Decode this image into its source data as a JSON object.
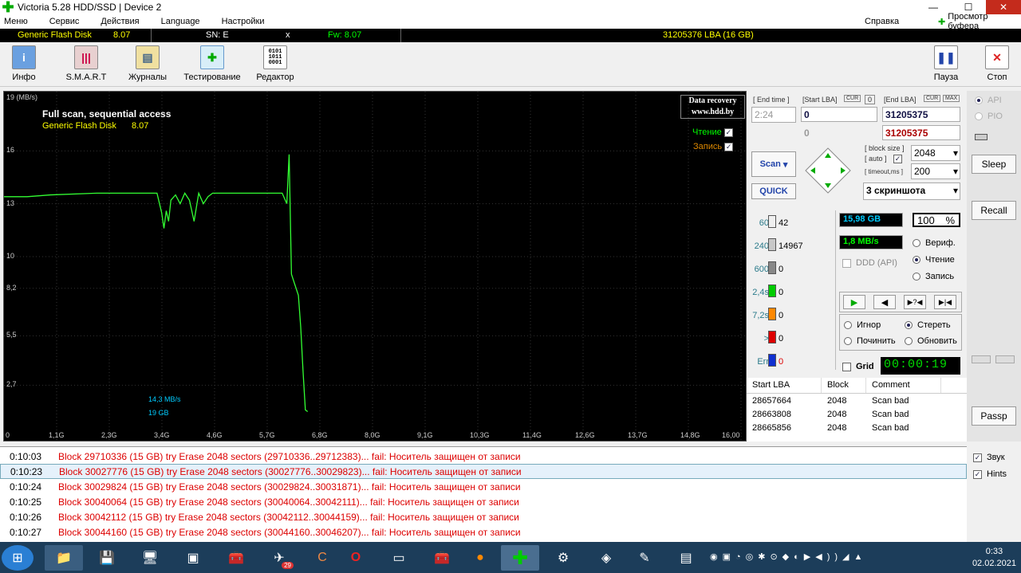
{
  "window": {
    "title": "Victoria 5.28 HDD/SSD | Device 2"
  },
  "menu": {
    "items": [
      "Меню",
      "Сервис",
      "Действия",
      "Language",
      "Настройки"
    ],
    "help": "Справка",
    "clipboard": "Просмотр буфера"
  },
  "device": {
    "name": "Generic Flash Disk",
    "rev": "8.07",
    "sn": "SN: E",
    "fw": "Fw: 8.07",
    "capacity": "31205376 LBA (16 GB)"
  },
  "toolbar": {
    "info": "Инфо",
    "smart": "S.M.A.R.T",
    "logs": "Журналы",
    "test": "Тестирование",
    "editor": "Редактор",
    "pause": "Пауза",
    "stop": "Стоп"
  },
  "graph": {
    "brand": "Data recovery\nwww.hdd.by",
    "title": "Full scan, sequential access",
    "device_line": "Generic Flash Disk",
    "device_rev": "8.07",
    "read_label": "Чтение",
    "write_label": "Запись",
    "speed_label": "14,3 MB/s",
    "pos_label": "19 GB",
    "unit_top": "19 (MB/s)"
  },
  "chart_data": {
    "type": "line",
    "ylabel": "MB/s",
    "y_ticks": [
      "16",
      "13",
      "10",
      "8,2",
      "5,5",
      "2,7"
    ],
    "x_ticks": [
      "0",
      "1,1G",
      "2,3G",
      "3,4G",
      "4,6G",
      "5,7G",
      "6,8G",
      "8,0G",
      "9,1G",
      "10,3G",
      "11,4G",
      "12,6G",
      "13,7G",
      "14,8G",
      "16,00"
    ],
    "ylim": [
      0,
      19
    ],
    "xlim": [
      0,
      16
    ],
    "series": [
      {
        "name": "Чтение",
        "x": [
          0,
          0.5,
          1.0,
          2.0,
          3.0,
          3.3,
          3.4,
          3.45,
          3.5,
          3.55,
          3.6,
          3.7,
          3.8,
          3.9,
          4.0,
          4.1,
          4.2,
          4.3,
          4.4,
          4.5,
          5.0,
          5.5,
          6.0,
          6.1,
          6.15,
          6.2,
          6.25,
          6.3,
          6.35,
          6.4,
          6.45,
          6.5,
          6.55
        ],
        "y": [
          13.4,
          13.4,
          13.5,
          13.6,
          13.6,
          13.6,
          12.5,
          11.6,
          12.6,
          12.0,
          13.2,
          13.5,
          13.0,
          13.6,
          13.2,
          12.0,
          13.6,
          13.0,
          13.4,
          13.6,
          13.6,
          13.6,
          13.6,
          13.0,
          15.8,
          9.0,
          8.6,
          8.2,
          7.8,
          6.0,
          3.5,
          1.3,
          1.2
        ]
      }
    ]
  },
  "params": {
    "end_time_label": "[ End time ]",
    "end_time": "2:24",
    "start_lba_label": "[Start LBA]",
    "start_lba": "0",
    "start_lba2": "0",
    "end_lba_label": "[End LBA]",
    "end_lba": "31205375",
    "end_lba2": "31205375",
    "cur": "CUR",
    "zero": "0",
    "max": "MAX",
    "block_size_label": "[ block size ]",
    "auto_label": "[ auto ]",
    "timeout_label": "[ timeout,ms ]",
    "block_size": "2048",
    "timeout": "200",
    "scan": "Scan",
    "quick": "QUICK",
    "mode": "3 скриншота"
  },
  "counters": [
    {
      "label": "60",
      "value": "42",
      "color": "#f0f0f0"
    },
    {
      "label": "240",
      "value": "14967",
      "color": "#c8c8c8"
    },
    {
      "label": "600",
      "value": "0",
      "color": "#888888"
    },
    {
      "label": "2,4s",
      "value": "0",
      "color": "#00cc00"
    },
    {
      "label": "7,2s",
      "value": "0",
      "color": "#ff8800"
    },
    {
      "label": ">",
      "value": "0",
      "color": "#dd0000"
    },
    {
      "label": "Err",
      "value": "0",
      "color": "#1030d0"
    }
  ],
  "status": {
    "size": "15,98 GB",
    "percent": "100",
    "pct_sign": "%",
    "speed": "1,8 MB/s",
    "ddd": "DDD (API)",
    "verify": "Вериф.",
    "read": "Чтение",
    "write": "Запись",
    "ignore": "Игнор",
    "erase": "Стереть",
    "repair": "Починить",
    "refresh": "Обновить",
    "grid": "Grid",
    "timer": "00:00:19"
  },
  "side": {
    "api": "API",
    "pio": "PIO",
    "sleep": "Sleep",
    "recall": "Recall",
    "passp": "Passp"
  },
  "table": {
    "headers": [
      "Start LBA",
      "Block",
      "Comment"
    ],
    "rows": [
      [
        "28657664",
        "2048",
        "Scan bad"
      ],
      [
        "28663808",
        "2048",
        "Scan bad"
      ],
      [
        "28665856",
        "2048",
        "Scan bad"
      ]
    ]
  },
  "log": [
    {
      "time": "0:10:03",
      "msg": "Block 29710336 (15 GB) try Erase 2048 sectors (29710336..29712383)... fail: Носитель защищен от записи"
    },
    {
      "time": "0:10:23",
      "msg": "Block 30027776 (15 GB) try Erase 2048 sectors (30027776..30029823)... fail: Носитель защищен от записи"
    },
    {
      "time": "0:10:24",
      "msg": "Block 30029824 (15 GB) try Erase 2048 sectors (30029824..30031871)... fail: Носитель защищен от записи"
    },
    {
      "time": "0:10:25",
      "msg": "Block 30040064 (15 GB) try Erase 2048 sectors (30040064..30042111)... fail: Носитель защищен от записи"
    },
    {
      "time": "0:10:26",
      "msg": "Block 30042112 (15 GB) try Erase 2048 sectors (30042112..30044159)... fail: Носитель защищен от записи"
    },
    {
      "time": "0:10:27",
      "msg": "Block 30044160 (15 GB) try Erase 2048 sectors (30044160..30046207)... fail: Носитель защищен от записи"
    }
  ],
  "logside": {
    "sound": "Звук",
    "hints": "Hints"
  },
  "clock": {
    "time": "0:33",
    "date": "02.02.2021"
  },
  "taskbar_badge": "29"
}
